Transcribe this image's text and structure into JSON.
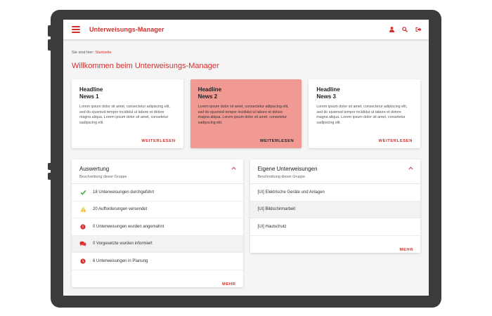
{
  "app": {
    "title": "Unterweisungs-Manager"
  },
  "breadcrumb": {
    "prefix": "Sie sind hier:",
    "current": "Startseite"
  },
  "page": {
    "title": "Willkommen beim Unterweisungs-Manager"
  },
  "news": [
    {
      "title_line1": "Headline",
      "title_line2": "News 1",
      "text": "Lorem ipsum dolor sit amet, consectetur adipiscing elit, sed do ejusmod tempor incididut ut labore et dolore magna aliqua. Lorem ipsum dolor sit amet, consetetur sadipscing elit.",
      "link": "WEITERLESEN",
      "highlighted": false
    },
    {
      "title_line1": "Headline",
      "title_line2": "News 2",
      "text": "Lorem ipsum dolor sit amet, consectetur adipiscing elit, sed do ejusmod tempor incididut ut labore et dolore magna aliqua. Lorem ipsum dolor sit amet, consetetur sadipscing elit.",
      "link": "WEITERLESEN",
      "highlighted": true
    },
    {
      "title_line1": "Headline",
      "title_line2": "News 3",
      "text": "Lorem ipsum dolor sit amet, consectetur adipiscing elit, sed do ejusmod tempor incididut ut labore et dolore magna aliqua. Lorem ipsum dolor sit amet, consetetur sadipscing elit.",
      "link": "WEITERLESEN",
      "highlighted": false
    }
  ],
  "evaluation": {
    "title": "Auswertung",
    "subtitle": "Beschreibung dieser Gruppe",
    "items": [
      {
        "icon": "check-icon",
        "text": "18 Unterweisungen durchgeführt"
      },
      {
        "icon": "warning-icon",
        "text": "20 Aufforderungen versendet"
      },
      {
        "icon": "alert-circle-icon",
        "text": "0 Unterweisungen wurden angemahnt"
      },
      {
        "icon": "chat-bubbles-icon",
        "text": "0 Vorgesetzte wurden informiert"
      },
      {
        "icon": "clock-icon",
        "text": "6 Unterweisungen in Planung"
      }
    ],
    "more": "MEHR"
  },
  "own": {
    "title": "Eigene Unterweisungen",
    "subtitle": "Beschreibung dieser Gruppe",
    "items": [
      {
        "text": "[UI] Elektrische Geräte und Anlagen"
      },
      {
        "text": "[UI] Bildschirmarbeit"
      },
      {
        "text": "[UI] Hautschutz"
      }
    ],
    "more": "MEHR"
  },
  "colors": {
    "accent": "#d32f2f",
    "highlight_card": "#f19a93",
    "success": "#4caf50",
    "warning": "#fbc02d"
  }
}
